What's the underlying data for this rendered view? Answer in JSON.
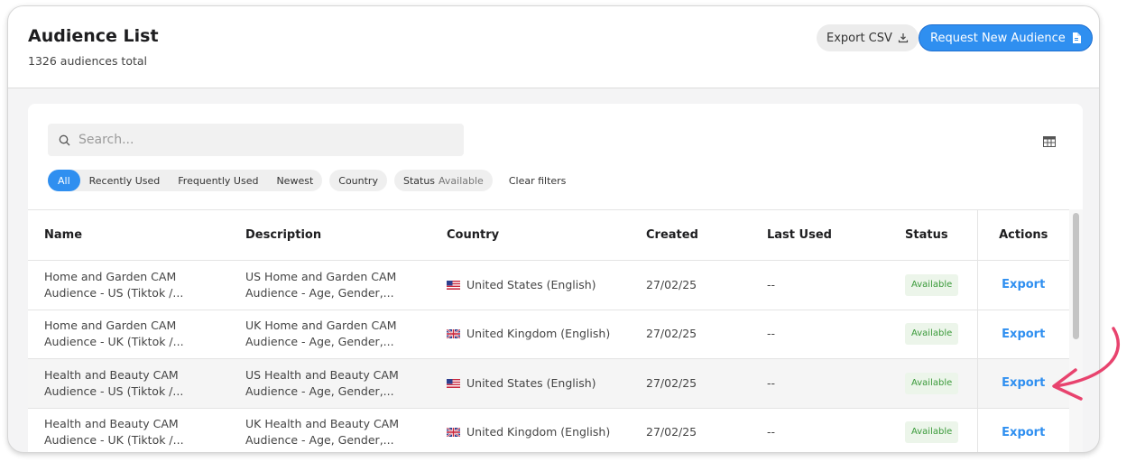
{
  "header": {
    "title": "Audience List",
    "subtitle": "1326 audiences total",
    "export_csv_label": "Export CSV",
    "request_label": "Request New Audience"
  },
  "search": {
    "placeholder": "Search..."
  },
  "filters": {
    "group": [
      "All",
      "Recently Used",
      "Frequently Used",
      "Newest"
    ],
    "country": "Country",
    "status_label": "Status",
    "status_value": "Available",
    "clear": "Clear filters"
  },
  "table": {
    "columns": [
      "Name",
      "Description",
      "Country",
      "Created",
      "Last Used",
      "Status",
      "Actions"
    ],
    "rows": [
      {
        "name": "Home and Garden CAM\nAudience - US (Tiktok /...",
        "description": "US Home and Garden CAM\nAudience - Age, Gender,...",
        "flag": "us-flag-icon",
        "country": "United States (English)",
        "created": "27/02/25",
        "last_used": "--",
        "status": "Available",
        "action": "Export"
      },
      {
        "name": "Home and Garden CAM\nAudience - UK (Tiktok /...",
        "description": "UK Home and Garden CAM\nAudience - Age, Gender,...",
        "flag": "uk-flag-icon",
        "country": "United Kingdom (English)",
        "created": "27/02/25",
        "last_used": "--",
        "status": "Available",
        "action": "Export"
      },
      {
        "name": "Health and Beauty CAM\nAudience - US (Tiktok /...",
        "description": "US Health and Beauty CAM\nAudience - Age, Gender,...",
        "flag": "us-flag-icon",
        "country": "United States (English)",
        "created": "27/02/25",
        "last_used": "--",
        "status": "Available",
        "action": "Export"
      },
      {
        "name": "Health and Beauty CAM\nAudience - UK (Tiktok /...",
        "description": "UK Health and Beauty CAM\nAudience - Age, Gender,...",
        "flag": "uk-flag-icon",
        "country": "United Kingdom (English)",
        "created": "27/02/25",
        "last_used": "--",
        "status": "Available",
        "action": "Export"
      }
    ]
  },
  "colors": {
    "accent": "#2f8ff0",
    "status_green": "#3a9a3a",
    "annotation_pink": "#e8436e"
  }
}
